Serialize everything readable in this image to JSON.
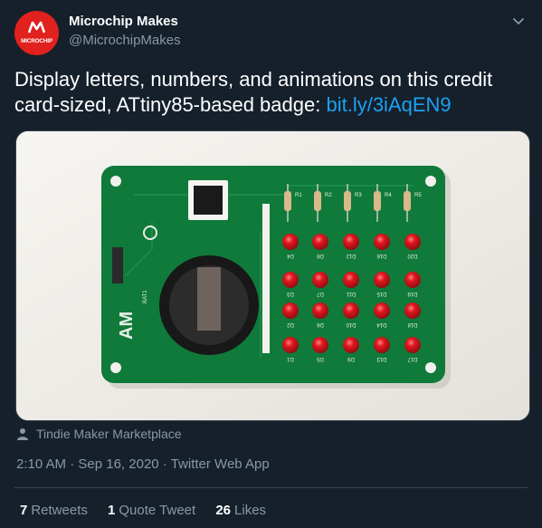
{
  "author": {
    "name": "Microchip Makes",
    "handle": "@MicrochipMakes",
    "avatar_text": "MICROCHIP"
  },
  "tweet": {
    "text": "Display letters, numbers, and animations on this credit card-sized, ATtiny85-based badge: ",
    "link": "bit.ly/3iAqEN9"
  },
  "board": {
    "led_labels": [
      "D4",
      "D8",
      "D12",
      "D16",
      "D20",
      "D3",
      "D7",
      "D11",
      "D15",
      "D19",
      "D2",
      "D6",
      "D10",
      "D14",
      "D18",
      "D1",
      "D5",
      "D9",
      "D13",
      "D17"
    ],
    "resistor_labels": [
      "R1",
      "R2",
      "R3",
      "R4",
      "R5"
    ],
    "silk_text": "AM",
    "silk_small": "20D162A4-121-19021",
    "bat_label": "BAT1"
  },
  "attribution": {
    "label": "Tindie Maker Marketplace",
    "icon": "person-icon"
  },
  "meta": {
    "time": "2:10 AM",
    "date": "Sep 16, 2020",
    "separator": "·",
    "source": "Twitter Web App"
  },
  "stats": {
    "retweets_count": "7",
    "retweets_label": "Retweets",
    "quotes_count": "1",
    "quotes_label": "Quote Tweet",
    "likes_count": "26",
    "likes_label": "Likes"
  },
  "colors": {
    "background": "#15202b",
    "secondary_text": "#8899a6",
    "link": "#1da1f2",
    "pcb_green": "#0f7a3a",
    "led_red": "#d4141c",
    "avatar_red": "#e0211d"
  }
}
